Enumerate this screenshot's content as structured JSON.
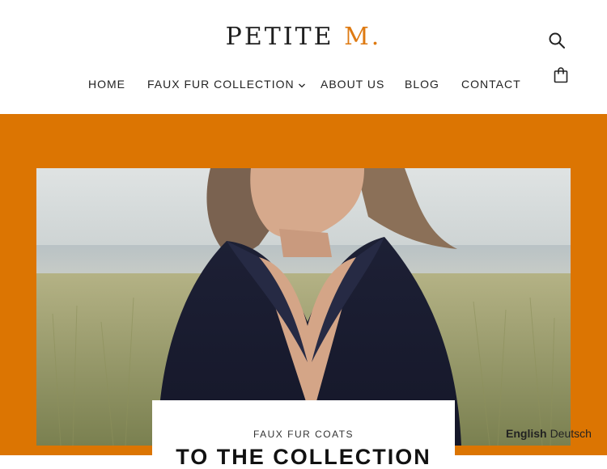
{
  "header": {
    "logo_main": "PETITE ",
    "logo_accent": "M."
  },
  "nav": {
    "items": [
      {
        "label": "HOME"
      },
      {
        "label": "FAUX FUR COLLECTION"
      },
      {
        "label": "ABOUT US"
      },
      {
        "label": "BLOG"
      },
      {
        "label": "CONTACT"
      }
    ]
  },
  "hero": {
    "subtitle": "FAUX FUR COATS",
    "title": "TO THE COLLECTION"
  },
  "language": {
    "active": "English",
    "other": "Deutsch"
  },
  "colors": {
    "accent": "#dc7502",
    "logo_accent": "#de7a12"
  },
  "icons": {
    "search": "search-icon",
    "cart": "shopping-bag-icon",
    "dropdown": "chevron-down-icon"
  }
}
